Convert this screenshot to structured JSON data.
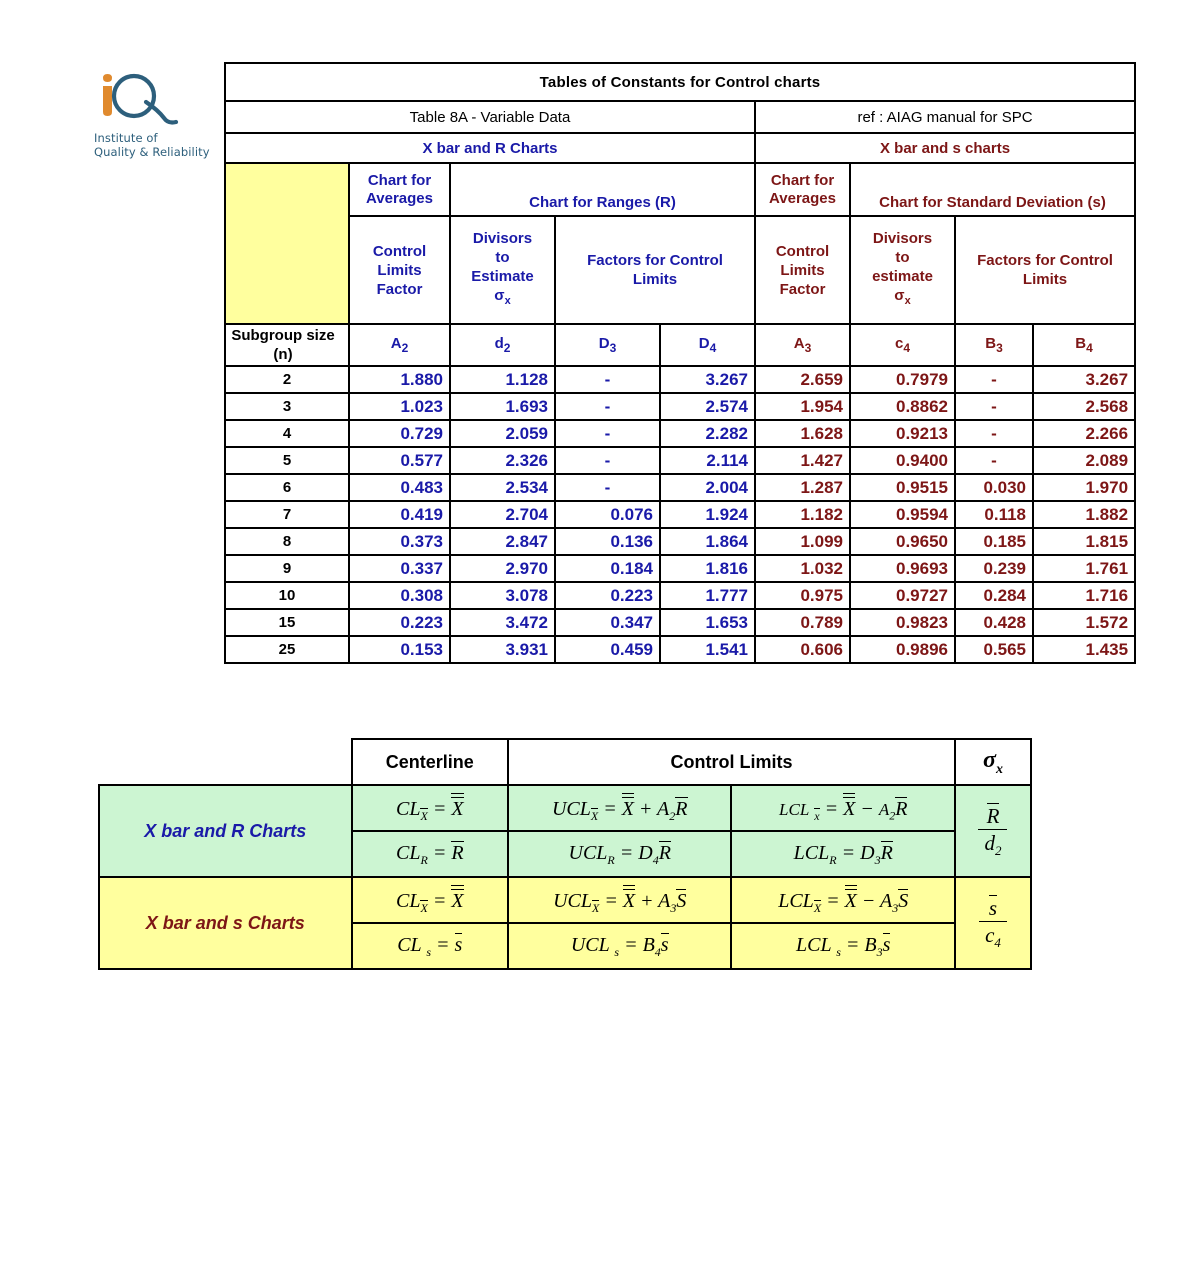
{
  "logo": {
    "icon": "iq-monogram-logo",
    "line1": "Institute of",
    "line2": "Quality & Reliability"
  },
  "header": {
    "title": "Tables of Constants for Control charts",
    "subtitle": "Table 8A - Variable Data",
    "reference": "ref : AIAG manual for SPC",
    "left_chart_family": "X bar and R Charts",
    "right_chart_family": "X bar and s charts"
  },
  "colors": {
    "blue": "#1a1aa8",
    "maroon": "#7d1616",
    "yellow": "#ffff9e",
    "green": "#ccf5d2"
  },
  "group_headers": {
    "left_averages": "Chart for Averages",
    "left_ranges": "Chart for Ranges (R)",
    "right_averages": "Chart for Averages",
    "right_stdev": "Chart for Standard Deviation (s)"
  },
  "sub_headers": {
    "a2": "Control Limits Factor",
    "d2": "Divisors to Estimate",
    "d2_sigma": "σ",
    "d2_sigma_sub": "x",
    "d34": "Factors for Control Limits",
    "a3": "Control Limits Factor",
    "c4": "Divisors to estimate",
    "c4_sigma": "σ",
    "c4_sigma_sub": "x",
    "b34": "Factors for Control Limits"
  },
  "table": {
    "row_label": "Subgroup size (n)",
    "row_label_line1": "Subgroup size",
    "row_label_line2": "(n)",
    "columns": [
      "A",
      "d",
      "D",
      "D",
      "A",
      "c",
      "B",
      "B"
    ],
    "column_subs": [
      "2",
      "2",
      "3",
      "4",
      "3",
      "4",
      "3",
      "4"
    ],
    "column_labels": [
      "A2",
      "d2",
      "D3",
      "D4",
      "A3",
      "c4",
      "B3",
      "B4"
    ],
    "dash": "-",
    "rows": [
      {
        "n": "2",
        "A2": "1.880",
        "d2": "1.128",
        "D3": "-",
        "D4": "3.267",
        "A3": "2.659",
        "c4": "0.7979",
        "B3": "-",
        "B4": "3.267"
      },
      {
        "n": "3",
        "A2": "1.023",
        "d2": "1.693",
        "D3": "-",
        "D4": "2.574",
        "A3": "1.954",
        "c4": "0.8862",
        "B3": "-",
        "B4": "2.568"
      },
      {
        "n": "4",
        "A2": "0.729",
        "d2": "2.059",
        "D3": "-",
        "D4": "2.282",
        "A3": "1.628",
        "c4": "0.9213",
        "B3": "-",
        "B4": "2.266"
      },
      {
        "n": "5",
        "A2": "0.577",
        "d2": "2.326",
        "D3": "-",
        "D4": "2.114",
        "A3": "1.427",
        "c4": "0.9400",
        "B3": "-",
        "B4": "2.089"
      },
      {
        "n": "6",
        "A2": "0.483",
        "d2": "2.534",
        "D3": "-",
        "D4": "2.004",
        "A3": "1.287",
        "c4": "0.9515",
        "B3": "0.030",
        "B4": "1.970"
      },
      {
        "n": "7",
        "A2": "0.419",
        "d2": "2.704",
        "D3": "0.076",
        "D4": "1.924",
        "A3": "1.182",
        "c4": "0.9594",
        "B3": "0.118",
        "B4": "1.882"
      },
      {
        "n": "8",
        "A2": "0.373",
        "d2": "2.847",
        "D3": "0.136",
        "D4": "1.864",
        "A3": "1.099",
        "c4": "0.9650",
        "B3": "0.185",
        "B4": "1.815"
      },
      {
        "n": "9",
        "A2": "0.337",
        "d2": "2.970",
        "D3": "0.184",
        "D4": "1.816",
        "A3": "1.032",
        "c4": "0.9693",
        "B3": "0.239",
        "B4": "1.761"
      },
      {
        "n": "10",
        "A2": "0.308",
        "d2": "3.078",
        "D3": "0.223",
        "D4": "1.777",
        "A3": "0.975",
        "c4": "0.9727",
        "B3": "0.284",
        "B4": "1.716"
      },
      {
        "n": "15",
        "A2": "0.223",
        "d2": "3.472",
        "D3": "0.347",
        "D4": "1.653",
        "A3": "0.789",
        "c4": "0.9823",
        "B3": "0.428",
        "B4": "1.572"
      },
      {
        "n": "25",
        "A2": "0.153",
        "d2": "3.931",
        "D3": "0.459",
        "D4": "1.541",
        "A3": "0.606",
        "c4": "0.9896",
        "B3": "0.565",
        "B4": "1.435"
      }
    ]
  },
  "formula_table": {
    "headers": {
      "centerline": "Centerline",
      "control_limits": "Control Limits",
      "sigma": "σ",
      "sigma_sub": "x"
    },
    "sections": [
      {
        "label": "X bar and R Charts",
        "sigma_num": "R",
        "sigma_den": "d",
        "sigma_den_sub": "2",
        "rows": [
          {
            "cl": "CL X̅ = X̿",
            "ucl": "UCL X̅ = X̿ + A₂R̅",
            "lcl": "LCL x̅ = X̿ − A₂R̅"
          },
          {
            "cl": "CL R = R̅",
            "ucl": "UCL R = D₄R̅",
            "lcl": "LCL R = D₃R̅"
          }
        ]
      },
      {
        "label": "X bar and s Charts",
        "sigma_num": "s",
        "sigma_den": "c",
        "sigma_den_sub": "4",
        "rows": [
          {
            "cl": "CL X̅ = X̿",
            "ucl": "UCL X̅ = X̿ + A₃s̅",
            "lcl": "LCL X̅ = X̿ − A₃s̅"
          },
          {
            "cl": "CL s = s̅",
            "ucl": "UCL s = B₄s̅",
            "lcl": "LCL s = B₃s̅"
          }
        ]
      }
    ]
  }
}
